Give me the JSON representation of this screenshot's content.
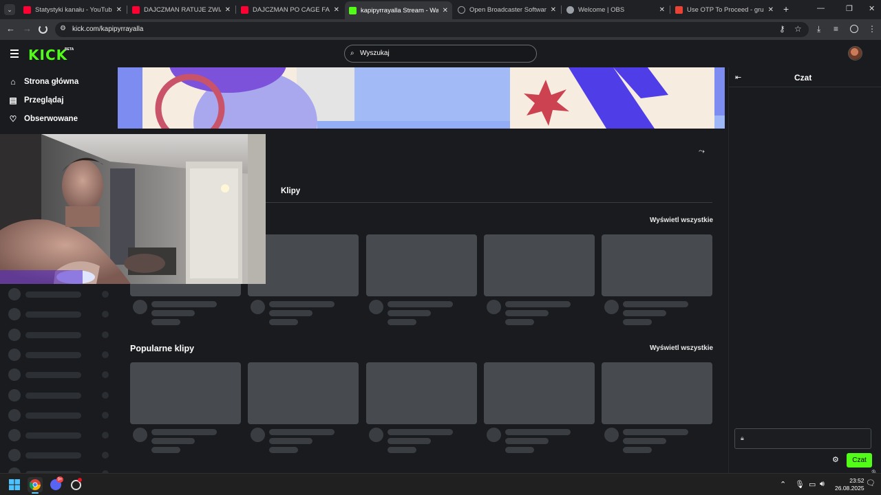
{
  "browser": {
    "tabs": [
      {
        "title": "Statystyki kanału - YouTube Stu",
        "favicon_color": "#ff0033"
      },
      {
        "title": "DAJCZMAN RATUJE ZWIĄZKI &",
        "favicon_color": "#ff0033"
      },
      {
        "title": "DAJCZMAN PO CAGE FAME ZD",
        "favicon_color": "#ff0033"
      },
      {
        "title": "kapipyrrayalla Stream - Watch L",
        "favicon_color": "#53fc18"
      },
      {
        "title": "Open Broadcaster Software | OB",
        "favicon_color": "#9aa0a6"
      },
      {
        "title": "Welcome | OBS",
        "favicon_color": "#9aa0a6"
      },
      {
        "title": "Use OTP To Proceed - grubykaj",
        "favicon_color": "#ea4335"
      }
    ],
    "close_glyph": "✕",
    "new_tab": "+",
    "url": "kick.com/kapipyrrayalla"
  },
  "kick": {
    "logo": "KICK",
    "beta": "BETA",
    "search_placeholder": "Wyszukaj",
    "nav": [
      {
        "label": "Strona główna",
        "icon": "home-icon"
      },
      {
        "label": "Przeglądaj",
        "icon": "browse-icon"
      },
      {
        "label": "Obserwowane",
        "icon": "heart-icon"
      }
    ],
    "tab_clips": "Klipy",
    "view_all_1": "Wyświetl wszystkie",
    "section2_title": "Popularne klipy",
    "view_all_2": "Wyświetl wszystkie"
  },
  "chat": {
    "title": "Czat",
    "send_label": "Czat"
  },
  "taskbar": {
    "time": "23:52",
    "date": "26.08.2025",
    "discord_badge": "9+"
  },
  "colors": {
    "kick_green": "#53fc18",
    "bg": "#191b1f"
  }
}
